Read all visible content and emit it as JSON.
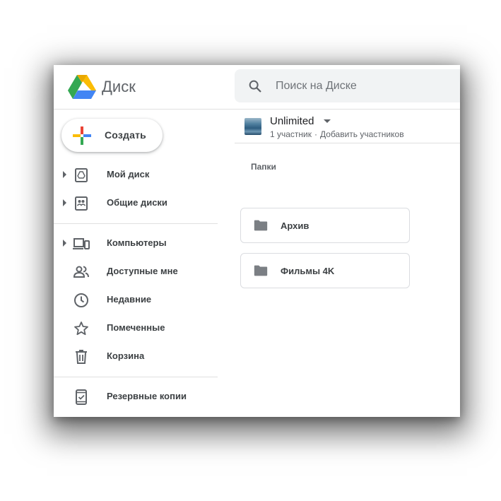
{
  "header": {
    "app_title": "Диск",
    "search_placeholder": "Поиск на Диске"
  },
  "sidebar": {
    "create_label": "Создать",
    "items": [
      {
        "label": "Мой диск",
        "icon": "my-drive-icon",
        "expandable": true
      },
      {
        "label": "Общие диски",
        "icon": "shared-drives-icon",
        "expandable": true
      },
      {
        "label": "Компьютеры",
        "icon": "computers-icon",
        "expandable": true
      },
      {
        "label": "Доступные мне",
        "icon": "shared-with-me-icon",
        "expandable": false
      },
      {
        "label": "Недавние",
        "icon": "clock-icon",
        "expandable": false
      },
      {
        "label": "Помеченные",
        "icon": "star-icon",
        "expandable": false
      },
      {
        "label": "Корзина",
        "icon": "trash-icon",
        "expandable": false
      },
      {
        "label": "Резервные копии",
        "icon": "backup-phone-icon",
        "expandable": false
      }
    ]
  },
  "main": {
    "drive_name": "Unlimited",
    "members_count": "1 участник",
    "members_separator": "·",
    "add_members": "Добавить участников",
    "folders_title": "Папки",
    "folders": [
      {
        "name": "Архив"
      },
      {
        "name": "Фильмы 4K"
      }
    ]
  },
  "colors": {
    "accent_blue": "#4285f4",
    "accent_green": "#34a853",
    "accent_yellow": "#fbbc04",
    "accent_red": "#ea4335",
    "icon_grey": "#5f6368"
  }
}
